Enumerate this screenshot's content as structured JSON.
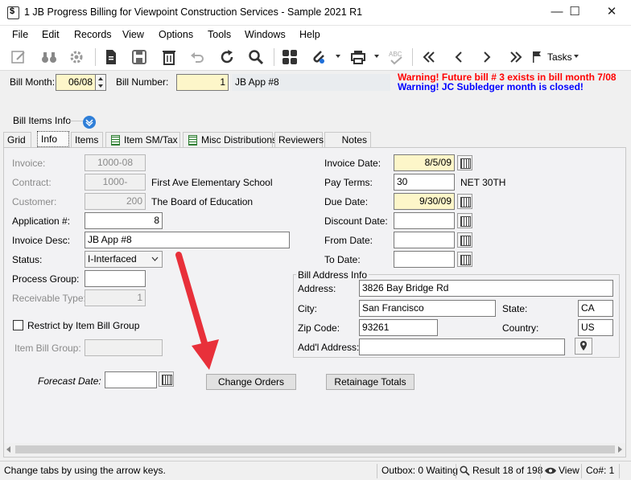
{
  "window": {
    "title": "1 JB Progress Billing for Viewpoint Construction Services - Sample 2021 R1",
    "minimize": "—",
    "maximize": "☐",
    "close": "✕"
  },
  "menu": [
    "File",
    "Edit",
    "Records",
    "View",
    "Options",
    "Tools",
    "Windows",
    "Help"
  ],
  "toolbar": {
    "icons": [
      "edit-icon",
      "binoculars-icon",
      "gear-icon",
      "new-document-icon",
      "save-icon",
      "delete-icon",
      "undo-icon",
      "refresh-icon",
      "search-icon",
      "grid-icon",
      "attach-icon",
      "print-icon",
      "spellcheck-icon",
      "first-record-icon",
      "previous-record-icon",
      "next-record-icon",
      "last-record-icon",
      "flag-icon"
    ],
    "tasks_label": "Tasks"
  },
  "header": {
    "bill_month_label": "Bill Month:",
    "bill_month_value": "06/08",
    "bill_number_label": "Bill Number:",
    "bill_number_value": "1",
    "bill_description": "JB App #8",
    "warning1": "Warning!  Future bill # 3 exists in bill month 7/08",
    "warning2": "Warning!  JC Subledger month is closed!",
    "warning1_color": "#ff0000",
    "warning2_color": "#0000ff"
  },
  "section_title": "Bill Items Info",
  "tabs": [
    "Grid",
    "Info",
    "Items",
    "Item SM/Tax",
    "Misc Distributions",
    "Reviewers",
    "Notes"
  ],
  "active_tab": "Info",
  "form": {
    "invoice_label": "Invoice:",
    "invoice_value": "1000-08",
    "contract_label": "Contract:",
    "contract_value": "1000-",
    "contract_desc": "First Ave Elementary School",
    "customer_label": "Customer:",
    "customer_value": "200",
    "customer_desc": "The Board of Education",
    "application_label": "Application #:",
    "application_value": "8",
    "invoice_desc_label": "Invoice Desc:",
    "invoice_desc_value": "JB App #8",
    "status_label": "Status:",
    "status_value": "I-Interfaced",
    "process_group_label": "Process Group:",
    "process_group_value": "",
    "receivable_type_label": "Receivable Type:",
    "receivable_type_value": "1",
    "restrict_label": "Restrict by Item Bill Group",
    "item_bill_group_label": "Item Bill Group:",
    "forecast_date_label": "Forecast Date:",
    "forecast_date_value": "",
    "invoice_date_label": "Invoice Date:",
    "invoice_date_value": "8/5/09",
    "pay_terms_label": "Pay Terms:",
    "pay_terms_value": "30",
    "pay_terms_desc": "NET 30TH",
    "due_date_label": "Due Date:",
    "due_date_value": "9/30/09",
    "discount_date_label": "Discount Date:",
    "discount_date_value": "",
    "from_date_label": "From Date:",
    "from_date_value": "",
    "to_date_label": "To Date:",
    "to_date_value": ""
  },
  "bill_address": {
    "title": "Bill Address Info",
    "address_label": "Address:",
    "address_value": "3826 Bay Bridge Rd",
    "city_label": "City:",
    "city_value": "San Francisco",
    "state_label": "State:",
    "state_value": "CA",
    "zip_label": "Zip Code:",
    "zip_value": "93261",
    "country_label": "Country:",
    "country_value": "US",
    "addl_label": "Add'l Address:",
    "addl_value": ""
  },
  "buttons": {
    "change_orders": "Change Orders",
    "retainage_totals": "Retainage Totals"
  },
  "status_bar": {
    "hint": "Change tabs by using the arrow keys.",
    "outbox": "Outbox: 0 Waiting",
    "result": "Result 18 of 198",
    "view": "View",
    "company": "Co#: 1"
  },
  "accent_color": "#e8303a"
}
